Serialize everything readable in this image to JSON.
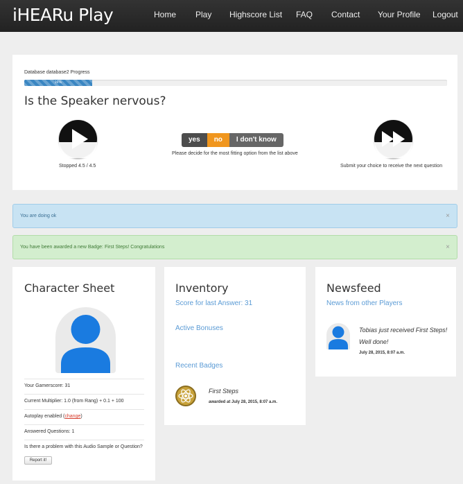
{
  "app": {
    "brand": "iHEARu Play"
  },
  "nav": {
    "home": "Home",
    "play": "Play",
    "highscore": "Highscore List",
    "faq": "FAQ",
    "contact": "Contact",
    "profile": "Your Profile",
    "logout": "Logout"
  },
  "quiz": {
    "progress_label": "Database database2 Progress",
    "progress_text": "16%",
    "progress_value": 16,
    "question": "Is the Speaker nervous?",
    "status": "Stopped 4.5 / 4.5",
    "options": {
      "yes": "yes",
      "no": "no",
      "dont_know": "I don't know"
    },
    "instruction": "Please decide for the most fitting option from the list above",
    "submit_hint": "Submit your choice to receive the next question"
  },
  "alerts": {
    "info": "You are doing ok",
    "success": "You have been awarded a new Badge: First Steps! Congratulations",
    "close": "×"
  },
  "character_sheet": {
    "title": "Character Sheet",
    "gamerscore": "Your Gamerscore: 31",
    "multiplier": "Current Multiplier: 1.0 (from Rang) + 0.1 + 100",
    "autoplay_prefix": "Autoplay enabled (",
    "autoplay_link": "change",
    "autoplay_suffix": ")",
    "answered": "Answered Questions: 1",
    "problem_question": "Is there a problem with this Audio Sample or Question?",
    "report_button": "Report it!"
  },
  "inventory": {
    "title": "Inventory",
    "score": "Score for last Answer: 31",
    "bonuses": "Active Bonuses",
    "recent_badges": "Recent Badges",
    "badge_name": "First Steps",
    "badge_awarded": "awarded at July 28, 2015, 8:07 a.m."
  },
  "newsfeed": {
    "title": "Newsfeed",
    "subtitle": "News from other Players",
    "item_text": "Tobias just received First Steps! Well done!",
    "item_time": "July 28, 2015, 8:07 a.m."
  },
  "colors": {
    "accent_blue": "#5b9bd5",
    "no_orange": "#f0961e",
    "avatar_blue": "#1a7be0",
    "link_red": "#d63b2b"
  }
}
